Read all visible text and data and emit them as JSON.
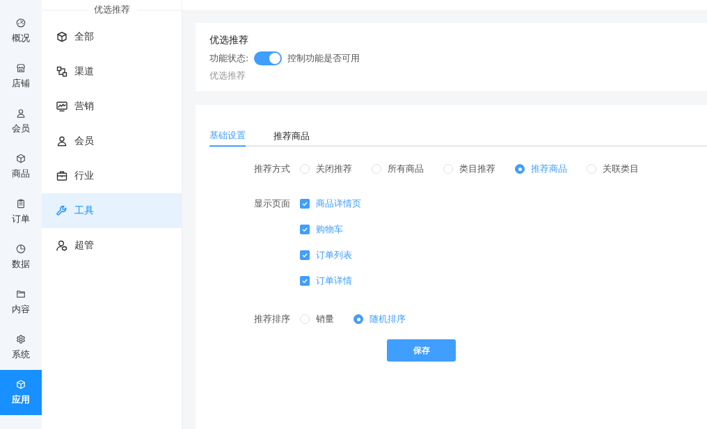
{
  "rail": {
    "items": [
      {
        "label": "概况",
        "kind": "gauge",
        "selected": false
      },
      {
        "label": "店铺",
        "kind": "shop",
        "selected": false
      },
      {
        "label": "会员",
        "kind": "user",
        "selected": false
      },
      {
        "label": "商品",
        "kind": "cube",
        "selected": false
      },
      {
        "label": "订单",
        "kind": "clipboard",
        "selected": false
      },
      {
        "label": "数据",
        "kind": "pie",
        "selected": false
      },
      {
        "label": "内容",
        "kind": "folder",
        "selected": false
      },
      {
        "label": "系统",
        "kind": "gear",
        "selected": false
      },
      {
        "label": "应用",
        "kind": "cube",
        "selected": true
      }
    ]
  },
  "submenu": {
    "title": "优选推荐",
    "items": [
      {
        "label": "全部",
        "kind": "cube",
        "selected": false
      },
      {
        "label": "渠道",
        "kind": "channels",
        "selected": false
      },
      {
        "label": "营销",
        "kind": "monitor",
        "selected": false
      },
      {
        "label": "会员",
        "kind": "user",
        "selected": false
      },
      {
        "label": "行业",
        "kind": "briefcase",
        "selected": false
      },
      {
        "label": "工具",
        "kind": "wrench",
        "selected": true
      },
      {
        "label": "超管",
        "kind": "admin",
        "selected": false
      }
    ]
  },
  "feature": {
    "title": "优选推荐",
    "status_label": "功能状态:",
    "on": true,
    "status_hint": "控制功能是否可用",
    "description": "优选推荐"
  },
  "tabs": [
    {
      "label": "基础设置",
      "selected": true
    },
    {
      "label": "推荐商品",
      "selected": false
    }
  ],
  "form": {
    "method": {
      "label": "推荐方式",
      "options": [
        {
          "label": "关闭推荐",
          "selected": false
        },
        {
          "label": "所有商品",
          "selected": false
        },
        {
          "label": "类目推荐",
          "selected": false
        },
        {
          "label": "推荐商品",
          "selected": true
        },
        {
          "label": "关联类目",
          "selected": false
        }
      ]
    },
    "pages": {
      "label": "显示页面",
      "options": [
        {
          "label": "商品详情页",
          "checked": true
        },
        {
          "label": "购物车",
          "checked": true
        },
        {
          "label": "订单列表",
          "checked": true
        },
        {
          "label": "订单详情",
          "checked": true
        }
      ]
    },
    "sort": {
      "label": "推荐排序",
      "options": [
        {
          "label": "销量",
          "selected": false
        },
        {
          "label": "随机排序",
          "selected": true
        }
      ]
    },
    "save": "保存"
  }
}
